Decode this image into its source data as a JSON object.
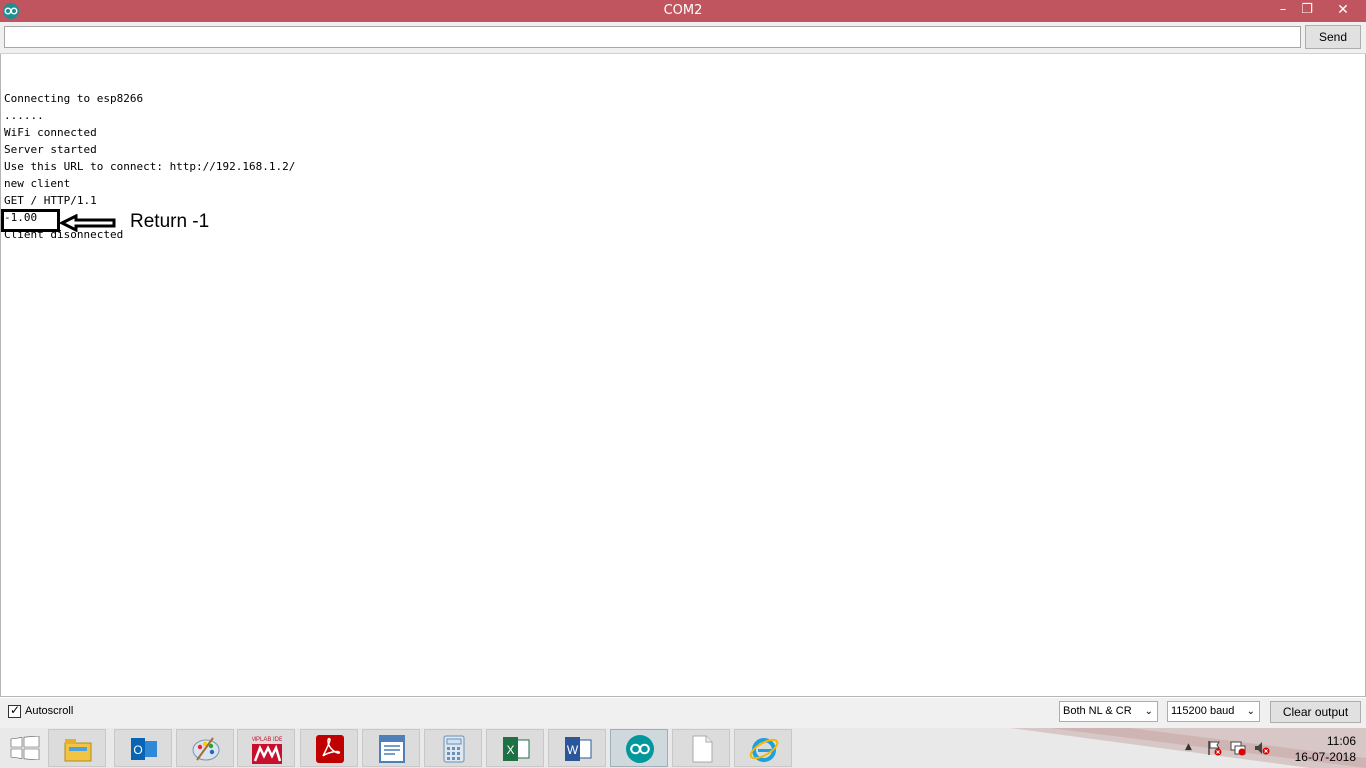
{
  "window": {
    "title": "COM2",
    "minimize": "–",
    "maximize": "❐",
    "close": "✕"
  },
  "input": {
    "value": "",
    "placeholder": ""
  },
  "send_label": "Send",
  "output": {
    "lines": [
      "Connecting to esp8266",
      "......",
      "WiFi connected",
      "Server started",
      "Use this URL to connect: http://192.168.1.2/",
      "new client",
      "GET / HTTP/1.1",
      "-1.00",
      "Client disonnected"
    ]
  },
  "annotation": {
    "text": "Return -1"
  },
  "bottom": {
    "autoscroll_label": "Autoscroll",
    "autoscroll_checked": true,
    "line_ending": "Both NL & CR",
    "baud": "115200 baud",
    "clear_label": "Clear output"
  },
  "taskbar": {
    "apps": [
      {
        "name": "file-explorer-icon",
        "color": "#f2c443"
      },
      {
        "name": "outlook-icon",
        "color": "#0a64b4"
      },
      {
        "name": "paint-icon",
        "color": "#8aa8c8"
      },
      {
        "name": "mplab-ide-icon",
        "color": "#c8102e",
        "label": "MPLAB IDE"
      },
      {
        "name": "acrobat-icon",
        "color": "#c00000"
      },
      {
        "name": "wordpad-icon",
        "color": "#4f7fb8"
      },
      {
        "name": "calculator-icon",
        "color": "#6a8fb8"
      },
      {
        "name": "excel-icon",
        "color": "#1e7145"
      },
      {
        "name": "word-icon",
        "color": "#2b579a"
      },
      {
        "name": "arduino-icon",
        "color": "#00979d"
      },
      {
        "name": "blank-file-icon",
        "color": "#ffffff"
      },
      {
        "name": "internet-explorer-icon",
        "color": "#1ea0e0"
      }
    ],
    "time": "11:06",
    "date": "16-07-2018"
  }
}
